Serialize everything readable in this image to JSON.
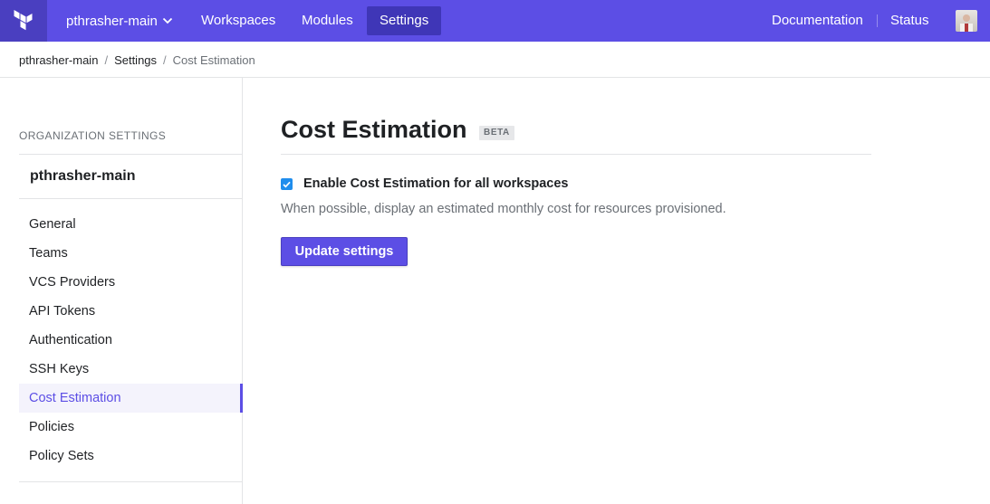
{
  "topbar": {
    "logo_icon": "terraform-logo-icon",
    "org_name": "pthrasher-main",
    "nav": [
      "Workspaces",
      "Modules",
      "Settings"
    ],
    "active_nav": "Settings",
    "right": {
      "documentation": "Documentation",
      "status": "Status"
    },
    "colors": {
      "bar": "#5c4ee5",
      "active": "#3f36b7"
    }
  },
  "breadcrumb": [
    "pthrasher-main",
    "Settings",
    "Cost Estimation"
  ],
  "sidebar": {
    "heading": "ORGANIZATION SETTINGS",
    "org_name": "pthrasher-main",
    "items": [
      "General",
      "Teams",
      "VCS Providers",
      "API Tokens",
      "Authentication",
      "SSH Keys",
      "Cost Estimation",
      "Policies",
      "Policy Sets"
    ],
    "active_item": "Cost Estimation"
  },
  "main": {
    "title": "Cost Estimation",
    "badge": "BETA",
    "checkbox": {
      "label": "Enable Cost Estimation for all workspaces",
      "checked": true
    },
    "help_text": "When possible, display an estimated monthly cost for resources provisioned.",
    "button": "Update settings"
  }
}
